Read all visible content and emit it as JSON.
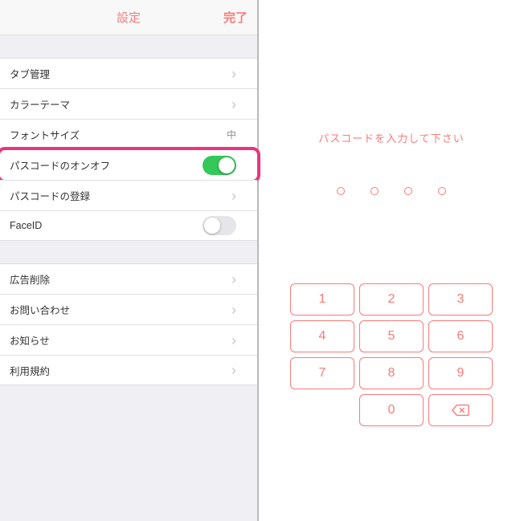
{
  "nav": {
    "title": "設定",
    "done": "完了"
  },
  "settings": {
    "group1": [
      {
        "label": "タブ管理",
        "type": "chevron"
      },
      {
        "label": "カラーテーマ",
        "type": "chevron"
      },
      {
        "label": "フォントサイズ",
        "type": "value",
        "value": "中"
      },
      {
        "label": "パスコードのオンオフ",
        "type": "switch",
        "on": true,
        "highlight": true
      },
      {
        "label": "パスコードの登録",
        "type": "chevron"
      },
      {
        "label": "FaceID",
        "type": "switch",
        "on": false
      }
    ],
    "group2": [
      {
        "label": "広告削除",
        "type": "chevron"
      },
      {
        "label": "お問い合わせ",
        "type": "chevron"
      },
      {
        "label": "お知らせ",
        "type": "chevron"
      },
      {
        "label": "利用規約",
        "type": "chevron"
      }
    ]
  },
  "passcode": {
    "prompt": "パスコードを入力して下さい",
    "digits": 4,
    "keys": [
      "1",
      "2",
      "3",
      "4",
      "5",
      "6",
      "7",
      "8",
      "9",
      "0"
    ]
  }
}
